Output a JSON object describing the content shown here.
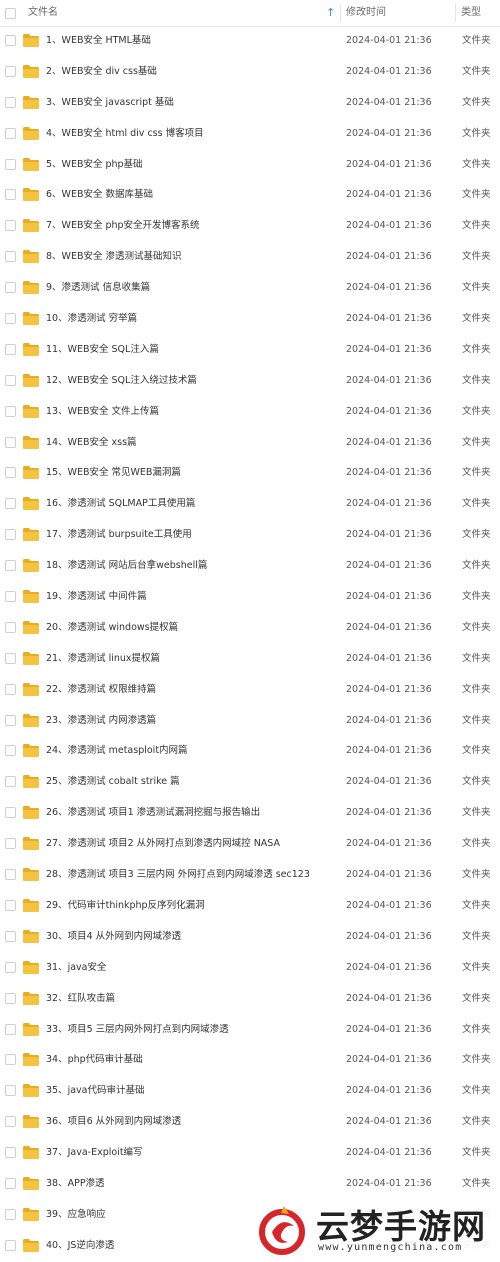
{
  "header": {
    "name_label": "文件名",
    "sort_icon": "arrow-up-icon",
    "time_label": "修改时间",
    "type_label": "类型"
  },
  "colors": {
    "folder": "#f5c342",
    "folder_dark": "#e9ad20",
    "sort": "#3c8ce7"
  },
  "files": [
    {
      "name": "1、WEB安全 HTML基础",
      "time": "2024-04-01 21:36",
      "type": "文件夹"
    },
    {
      "name": "2、WEB安全 div css基础",
      "time": "2024-04-01 21:36",
      "type": "文件夹"
    },
    {
      "name": "3、WEB安全 javascript 基础",
      "time": "2024-04-01 21:36",
      "type": "文件夹"
    },
    {
      "name": "4、WEB安全 html div css 博客项目",
      "time": "2024-04-01 21:36",
      "type": "文件夹"
    },
    {
      "name": "5、WEB安全 php基础",
      "time": "2024-04-01 21:36",
      "type": "文件夹"
    },
    {
      "name": "6、WEB安全 数据库基础",
      "time": "2024-04-01 21:36",
      "type": "文件夹"
    },
    {
      "name": "7、WEB安全 php安全开发博客系统",
      "time": "2024-04-01 21:36",
      "type": "文件夹"
    },
    {
      "name": "8、WEB安全 渗透测试基础知识",
      "time": "2024-04-01 21:36",
      "type": "文件夹"
    },
    {
      "name": "9、渗透测试 信息收集篇",
      "time": "2024-04-01 21:36",
      "type": "文件夹"
    },
    {
      "name": "10、渗透测试 穷举篇",
      "time": "2024-04-01 21:36",
      "type": "文件夹"
    },
    {
      "name": "11、WEB安全 SQL注入篇",
      "time": "2024-04-01 21:36",
      "type": "文件夹"
    },
    {
      "name": "12、WEB安全 SQL注入绕过技术篇",
      "time": "2024-04-01 21:36",
      "type": "文件夹"
    },
    {
      "name": "13、WEB安全 文件上传篇",
      "time": "2024-04-01 21:36",
      "type": "文件夹"
    },
    {
      "name": "14、WEB安全 xss篇",
      "time": "2024-04-01 21:36",
      "type": "文件夹"
    },
    {
      "name": "15、WEB安全 常见WEB漏洞篇",
      "time": "2024-04-01 21:36",
      "type": "文件夹"
    },
    {
      "name": "16、渗透测试 SQLMAP工具使用篇",
      "time": "2024-04-01 21:36",
      "type": "文件夹"
    },
    {
      "name": "17、渗透测试 burpsuite工具使用",
      "time": "2024-04-01 21:36",
      "type": "文件夹"
    },
    {
      "name": "18、渗透测试 网站后台拿webshell篇",
      "time": "2024-04-01 21:36",
      "type": "文件夹"
    },
    {
      "name": "19、渗透测试 中间件篇",
      "time": "2024-04-01 21:36",
      "type": "文件夹"
    },
    {
      "name": "20、渗透测试 windows提权篇",
      "time": "2024-04-01 21:36",
      "type": "文件夹"
    },
    {
      "name": "21、渗透测试 linux提权篇",
      "time": "2024-04-01 21:36",
      "type": "文件夹"
    },
    {
      "name": "22、渗透测试 权限维持篇",
      "time": "2024-04-01 21:36",
      "type": "文件夹"
    },
    {
      "name": "23、渗透测试 内网渗透篇",
      "time": "2024-04-01 21:36",
      "type": "文件夹"
    },
    {
      "name": "24、渗透测试 metasploit内网篇",
      "time": "2024-04-01 21:36",
      "type": "文件夹"
    },
    {
      "name": "25、渗透测试 cobalt strike 篇",
      "time": "2024-04-01 21:36",
      "type": "文件夹"
    },
    {
      "name": "26、渗透测试 项目1 渗透测试漏洞挖掘与报告输出",
      "time": "2024-04-01 21:36",
      "type": "文件夹"
    },
    {
      "name": "27、渗透测试 项目2 从外网打点到渗透内网域控 NASA",
      "time": "2024-04-01 21:36",
      "type": "文件夹"
    },
    {
      "name": "28、渗透测试 项目3 三层内网 外网打点到内网域渗透 sec123",
      "time": "2024-04-01 21:36",
      "type": "文件夹"
    },
    {
      "name": "29、代码审计thinkphp反序列化漏洞",
      "time": "2024-04-01 21:36",
      "type": "文件夹"
    },
    {
      "name": "30、项目4 从外网到内网域渗透",
      "time": "2024-04-01 21:36",
      "type": "文件夹"
    },
    {
      "name": "31、java安全",
      "time": "2024-04-01 21:36",
      "type": "文件夹"
    },
    {
      "name": "32、红队攻击篇",
      "time": "2024-04-01 21:36",
      "type": "文件夹"
    },
    {
      "name": "33、项目5 三层内网外网打点到内网域渗透",
      "time": "2024-04-01 21:36",
      "type": "文件夹"
    },
    {
      "name": "34、php代码审计基础",
      "time": "2024-04-01 21:36",
      "type": "文件夹"
    },
    {
      "name": "35、java代码审计基础",
      "time": "2024-04-01 21:36",
      "type": "文件夹"
    },
    {
      "name": "36、项目6 从外网到内网域渗透",
      "time": "2024-04-01 21:36",
      "type": "文件夹"
    },
    {
      "name": "37、Java-Exploit编写",
      "time": "2024-04-01 21:36",
      "type": "文件夹"
    },
    {
      "name": "38、APP渗透",
      "time": "2024-04-01 21:36",
      "type": "文件夹"
    },
    {
      "name": "39、应急响应",
      "time": "2024-04-01 21:36",
      "type": "文件夹"
    },
    {
      "name": "40、JS逆向渗透",
      "time": "2024-04-01 21:36",
      "type": "文件夹"
    }
  ],
  "watermark": {
    "title": "云梦手游网",
    "url": "www.yunmengchina.com",
    "logo_icon": "yunmeng-logo-icon"
  }
}
